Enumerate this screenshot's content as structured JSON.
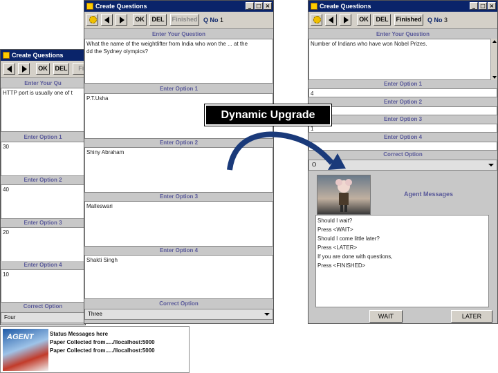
{
  "windows": {
    "w1": {
      "title": "Create Questions",
      "buttons": {
        "ok": "OK",
        "del": "DEL",
        "finished": "Fin"
      },
      "question_label": "Enter Your Qu",
      "question_text": "HTTP port is usually one of t",
      "option1_label": "Enter Option 1",
      "option1_value": "30",
      "option2_label": "Enter Option 2",
      "option2_value": "40",
      "option3_label": "Enter Option 3",
      "option3_value": "20",
      "option4_label": "Enter Option 4",
      "option4_value": "10",
      "correct_label": "Correct Option",
      "correct_value": "Four"
    },
    "w2": {
      "title": "Create Questions",
      "buttons": {
        "ok": "OK",
        "del": "DEL",
        "finished": "Finished"
      },
      "qno_label": "Q No",
      "qno_value": "1",
      "question_label": "Enter Your Question",
      "question_text": "What the name of the weightlifter from India who won the ... at the\ndd the Sydney olympics?",
      "option1_label": "Enter Option 1",
      "option1_value": "P.T.Usha",
      "option2_label": "Enter Option 2",
      "option2_value": "Shiny Abraham",
      "option3_label": "Enter Option 3",
      "option3_value": "Malleswari",
      "option4_label": "Enter Option 4",
      "option4_value": "Shakti Singh",
      "correct_label": "Correct Option",
      "correct_value": "Three"
    },
    "w3": {
      "title": "Create Questions",
      "buttons": {
        "ok": "OK",
        "del": "DEL",
        "finished": "Finished"
      },
      "qno_label": "Q No",
      "qno_value": "3",
      "question_label": "Enter Your Question",
      "question_text": "Number of Indians who have won Nobel Prizes.",
      "option1_label": "Enter Option 1",
      "option1_value": "4",
      "option2_label": "Enter Option 2",
      "option2_value": "",
      "option3_label": "Enter Option 3",
      "option3_value": "1",
      "option4_label": "Enter Option 4",
      "option4_value": "",
      "correct_label": "Correct Option",
      "correct_value": "O",
      "agent_messages_label": "Agent Messages",
      "agent_text": "Should I wait?\nPress <WAIT>\nShould I come little later?\nPress <LATER>\nIf you are done with questions,\nPress <FINISHED>",
      "wait_button": "WAIT",
      "later_button": "LATER"
    }
  },
  "callout": "Dynamic Upgrade",
  "status_panel": {
    "logo_text": "AGENT",
    "lines": [
      "Status Messages here",
      "Paper Collected from.....//localhost:5000",
      "Paper Collected from.....//localhost:5000"
    ]
  },
  "colors": {
    "title_bar": "#0a246a",
    "label_text": "#5a5a9a",
    "arrow": "#1a3a7a"
  }
}
